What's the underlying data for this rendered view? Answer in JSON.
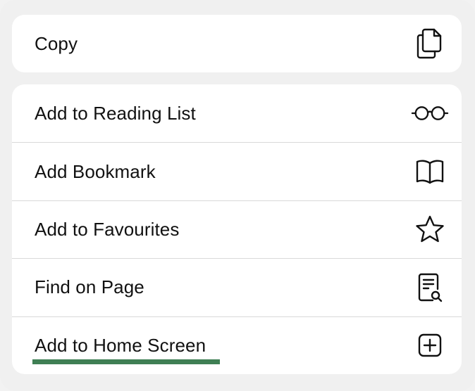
{
  "menu": {
    "top_items": [
      {
        "label": "Copy",
        "icon": "copy-icon"
      }
    ],
    "items": [
      {
        "label": "Add to Reading List",
        "icon": "glasses-icon"
      },
      {
        "label": "Add Bookmark",
        "icon": "book-icon"
      },
      {
        "label": "Add to Favourites",
        "icon": "star-icon"
      },
      {
        "label": "Find on Page",
        "icon": "document-search-icon"
      },
      {
        "label": "Add to Home Screen",
        "icon": "plus-square-icon"
      }
    ]
  },
  "colors": {
    "underline": "#3f7f54",
    "text": "#111111",
    "background": "#f0f0f0",
    "card": "#ffffff"
  }
}
